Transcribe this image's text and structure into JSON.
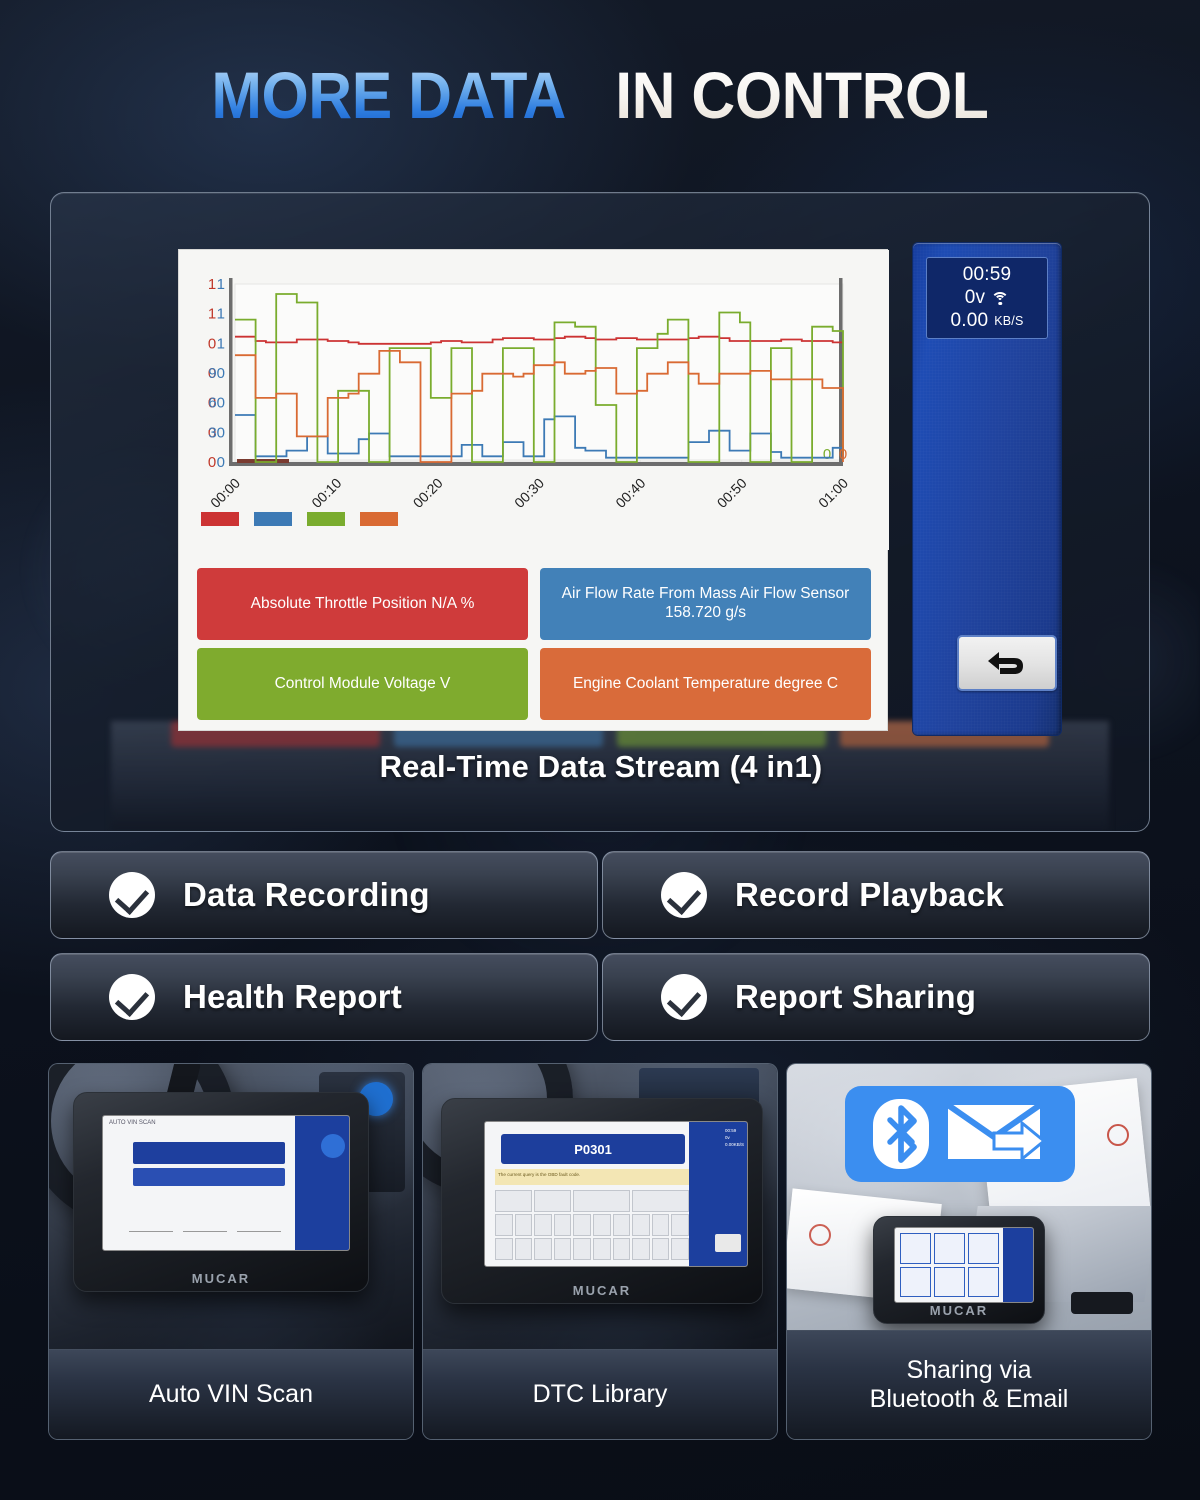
{
  "headline": {
    "blue_part": "MORE DATA",
    "white_part": "IN CONTROL"
  },
  "hero": {
    "caption": "Real-Time Data Stream (4 in1)",
    "device_status": {
      "timer": "00:59",
      "voltage_value": "0v",
      "wifi_icon": "wifi-icon",
      "rate_value": "0.00",
      "rate_unit": "KB/S"
    },
    "back_button_icon": "back-arrow-icon",
    "cards": [
      {
        "label": "Absolute Throttle Position N/A %",
        "color": "#cf3b3b",
        "series_color_name": "red"
      },
      {
        "label": "Air Flow Rate From Mass Air Flow Sensor 158.720 g/s",
        "color": "#4281b8",
        "series_color_name": "blue"
      },
      {
        "label": "Control Module Voltage  V",
        "color": "#7fab2e",
        "series_color_name": "green"
      },
      {
        "label": "Engine Coolant Temperature  degree C",
        "color": "#d96b3a",
        "series_color_name": "orange"
      }
    ]
  },
  "chart_data": {
    "type": "line",
    "title": "Real-Time Data Stream (4 in1)",
    "xlabel": "",
    "ylabel": "",
    "grid": true,
    "legend_position": "bottom-left",
    "x_tick_labels": [
      "00:00",
      "00:10",
      "00:20",
      "00:30",
      "00:40",
      "00:50",
      "01:00"
    ],
    "x_tick_rotation_deg": -45,
    "left_axis_ticks_outer": [
      "1",
      "1",
      "0",
      "0",
      "0",
      "0",
      "0"
    ],
    "left_axis_ticks_inner": [
      "1",
      "1",
      "1",
      "90",
      "60",
      "30",
      "0"
    ],
    "right_axis_ticks": [
      "0",
      "0"
    ],
    "right_axis_tick_colors": [
      "#7aac2e",
      "#d96a33"
    ],
    "series": [
      {
        "name": "Absolute Throttle Position N/A %",
        "color": "#cc3333",
        "values": [
          88,
          88,
          85,
          84,
          84,
          84,
          86,
          86,
          86,
          85,
          85,
          84,
          83,
          83,
          83,
          83,
          83,
          83,
          83,
          84,
          85,
          85,
          84,
          84,
          84,
          86,
          87,
          87,
          87,
          86,
          86,
          87,
          88,
          88,
          87,
          86,
          86,
          87,
          87,
          86,
          86,
          86,
          86,
          86,
          87,
          88,
          88,
          87,
          85,
          85,
          85,
          85,
          85,
          86,
          86,
          85,
          85,
          85,
          84,
          84
        ]
      },
      {
        "name": "Air Flow Rate From Mass Air Flow Sensor 158.720 g/s",
        "color": "#3d7ab5",
        "values": [
          33,
          33,
          4,
          4,
          4,
          8,
          8,
          18,
          18,
          6,
          6,
          6,
          16,
          20,
          20,
          4,
          4,
          4,
          4,
          4,
          4,
          4,
          12,
          12,
          4,
          4,
          14,
          14,
          4,
          4,
          30,
          32,
          32,
          10,
          8,
          8,
          3,
          3,
          3,
          3,
          3,
          3,
          3,
          3,
          14,
          14,
          22,
          22,
          8,
          8,
          20,
          20,
          7,
          3,
          3,
          3,
          3,
          3,
          10,
          3
        ]
      },
      {
        "name": "Control Module Voltage  V",
        "color": "#7aac2e",
        "values": [
          100,
          100,
          0,
          0,
          118,
          118,
          112,
          112,
          0,
          0,
          50,
          50,
          50,
          0,
          0,
          80,
          80,
          80,
          80,
          45,
          45,
          80,
          80,
          0,
          0,
          0,
          80,
          80,
          80,
          0,
          0,
          98,
          98,
          95,
          95,
          40,
          40,
          0,
          0,
          80,
          80,
          90,
          100,
          100,
          0,
          0,
          0,
          105,
          105,
          98,
          0,
          0,
          80,
          80,
          0,
          0,
          95,
          95,
          92,
          5
        ]
      },
      {
        "name": "Engine Coolant Temperature  degree C",
        "color": "#d96a33",
        "values": [
          75,
          75,
          45,
          45,
          48,
          48,
          18,
          18,
          18,
          45,
          45,
          48,
          62,
          62,
          78,
          78,
          70,
          70,
          0,
          0,
          0,
          48,
          48,
          50,
          62,
          62,
          62,
          60,
          62,
          68,
          68,
          70,
          62,
          62,
          64,
          66,
          66,
          48,
          48,
          50,
          62,
          62,
          70,
          70,
          62,
          55,
          55,
          62,
          62,
          62,
          64,
          64,
          58,
          58,
          58,
          58,
          58,
          52,
          52,
          0
        ]
      }
    ]
  },
  "features": [
    {
      "label": "Data Recording",
      "icon": "check-circle-icon"
    },
    {
      "label": "Record Playback",
      "icon": "check-circle-icon"
    },
    {
      "label": "Health Report",
      "icon": "check-circle-icon"
    },
    {
      "label": "Report Sharing",
      "icon": "check-circle-icon"
    }
  ],
  "photos": [
    {
      "caption": "Auto VIN Scan",
      "screen_text": "AUTO VIN SCAN",
      "brand": "MUCAR"
    },
    {
      "caption": "DTC Library",
      "screen_text": "P0301",
      "hint_text": "The current query is the OBD fault code.",
      "brand": "MUCAR"
    },
    {
      "caption": "Sharing via\nBluetooth & Email",
      "caption_line1": "Sharing via",
      "caption_line2": "Bluetooth & Email",
      "icons": [
        "bluetooth-icon",
        "email-send-icon"
      ],
      "badge_color": "#3b8ef0",
      "brand": "MUCAR"
    }
  ]
}
